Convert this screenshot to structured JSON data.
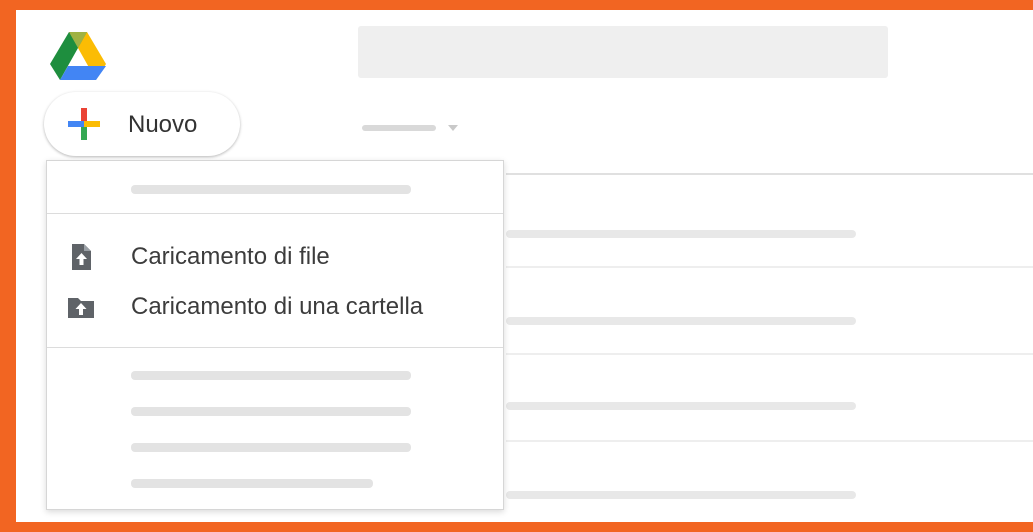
{
  "new_button": {
    "label": "Nuovo"
  },
  "menu": {
    "items": [
      {
        "label": "Caricamento di file",
        "icon": "file-upload-icon"
      },
      {
        "label": "Caricamento di una cartella",
        "icon": "folder-upload-icon"
      }
    ]
  },
  "colors": {
    "frame_border": "#f26522",
    "drive_green": "#1e8e3e",
    "drive_yellow": "#fbbc04",
    "drive_blue": "#4285f4",
    "plus_red": "#ea4335",
    "plus_yellow": "#fbbc04",
    "plus_green": "#34a853",
    "plus_blue": "#4285f4"
  }
}
